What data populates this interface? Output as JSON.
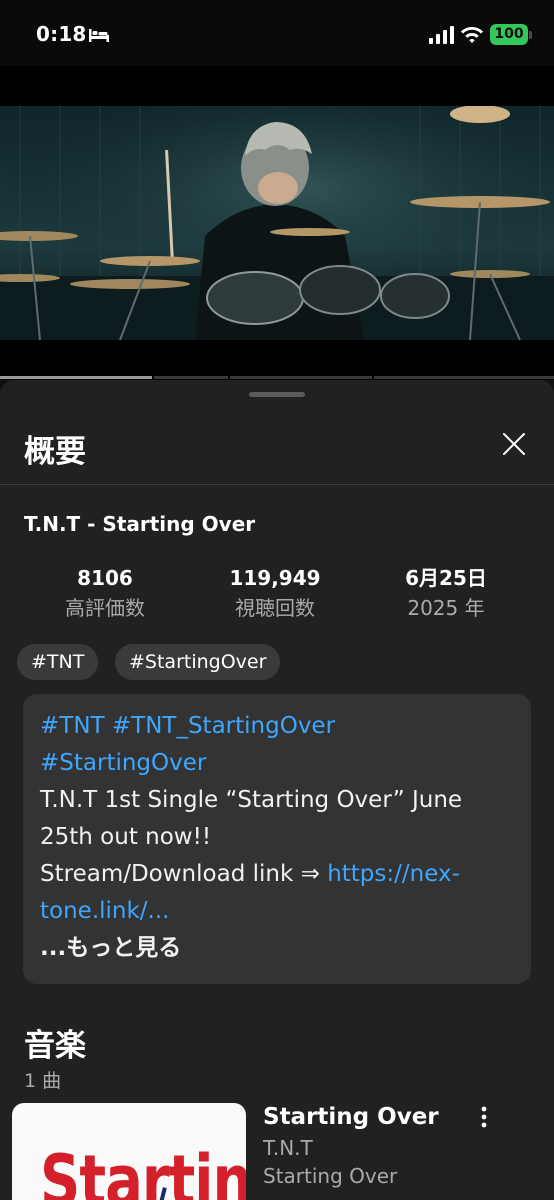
{
  "status_bar": {
    "time": "0:18",
    "battery": "100"
  },
  "video": {
    "progress": 0.275
  },
  "sheet": {
    "title": "概要",
    "video_title": "T.N.T - Starting Over",
    "stats": [
      {
        "value": "8106",
        "label": "高評価数"
      },
      {
        "value": "119,949",
        "label": "視聴回数"
      },
      {
        "value": "6月25日",
        "label": "2025 年"
      }
    ],
    "tags": [
      "#TNT",
      "#StartingOver"
    ],
    "description": {
      "hashtags_line1": "#TNT #TNT_StartingOver",
      "hashtags_line2": "#StartingOver",
      "text_line1": "T.N.T 1st Single “Starting Over” June",
      "text_line2": "25th out now!!",
      "text_line3_prefix": "Stream/Download link ⇒ ",
      "link_part1": "https://nex-",
      "link_part2": "tone.link/...",
      "more": "...もっと見る"
    },
    "music": {
      "title": "音楽",
      "count": "1 曲",
      "song": {
        "title": "Starting Over",
        "artist": "T.N.T",
        "album": "Starting Over",
        "thumbnail_text": "Starting"
      }
    }
  },
  "colors": {
    "link": "#3ea6ff",
    "battery": "#34c759",
    "sheet_bg": "#212121",
    "thumb_text": "#d4202a"
  }
}
